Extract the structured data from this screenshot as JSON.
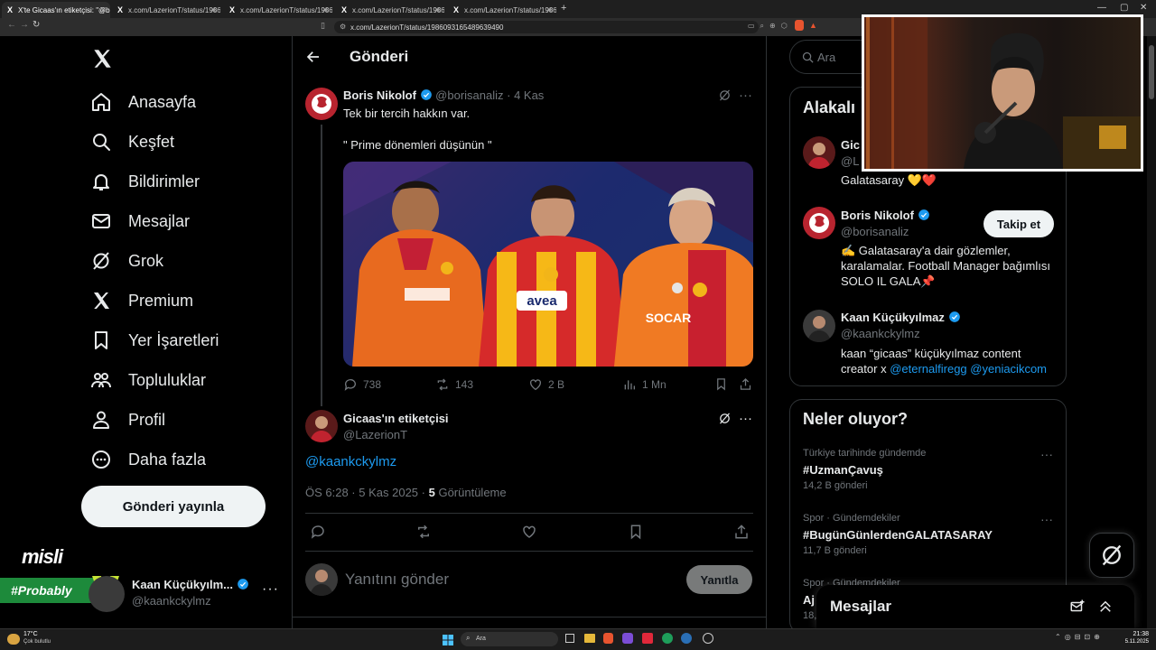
{
  "browser": {
    "tabs": [
      {
        "label": "X'te Gicaas'ın etiketçisi: \"@borisa"
      },
      {
        "label": "x.com/LazerionT/status/198609320"
      },
      {
        "label": "x.com/LazerionT/status/198609330"
      },
      {
        "label": "x.com/LazerionT/status/198609345"
      },
      {
        "label": "x.com/LazerionT/status/198611676"
      }
    ],
    "url": "x.com/LazerionT/status/1986093165489639490"
  },
  "sidebar": {
    "items": [
      {
        "label": "Anasayfa",
        "icon": "home-icon"
      },
      {
        "label": "Keşfet",
        "icon": "search-icon"
      },
      {
        "label": "Bildirimler",
        "icon": "bell-icon"
      },
      {
        "label": "Mesajlar",
        "icon": "mail-icon"
      },
      {
        "label": "Grok",
        "icon": "grok-icon"
      },
      {
        "label": "Premium",
        "icon": "x-logo-icon"
      },
      {
        "label": "Yer İşaretleri",
        "icon": "bookmark-icon"
      },
      {
        "label": "Topluluklar",
        "icon": "communities-icon"
      },
      {
        "label": "Profil",
        "icon": "person-icon"
      },
      {
        "label": "Daha fazla",
        "icon": "more-circle-icon"
      }
    ],
    "post_button": "Gönderi yayınla",
    "account": {
      "name": "Kaan Küçükyılm...",
      "handle": "@kaankckylmz"
    },
    "overlay_logo": "misli",
    "overlay_tag": "#Probably"
  },
  "header": {
    "title": "Gönderi"
  },
  "parent_post": {
    "name": "Boris Nikolof",
    "handle": "@borisanaliz",
    "time": "· 4 Kas",
    "line1": "Tek bir tercih hakkın var.",
    "line2": "\" Prime dönemleri düşünün \"",
    "stats": {
      "replies": "738",
      "reposts": "143",
      "likes": "2 B",
      "views": "1 Mn"
    }
  },
  "main_post": {
    "name": "Gicaas'ın etiketçisi",
    "handle": "@LazerionT",
    "mention": "@kaankckylmz",
    "timestamp": "ÖS 6:28 · 5 Kas 2025 ·",
    "views_count": "5",
    "views_label": "Görüntüleme"
  },
  "reply": {
    "placeholder": "Yanıtını gönder",
    "button": "Yanıtla"
  },
  "right": {
    "search_placeholder": "Ara",
    "related_title": "Alakalı",
    "related": [
      {
        "name": "Gic",
        "handle": "@L",
        "bio": "Galatasaray 💛❤️"
      },
      {
        "name": "Boris Nikolof",
        "handle": "@borisanaliz",
        "bio": "✍️ Galatasaray'a dair gözlemler, karalamalar. Football Manager bağımlısı SOLO IL GALA📌",
        "follow": "Takip et"
      },
      {
        "name": "Kaan Küçükyılmaz",
        "handle": "@kaankckylmz",
        "bio_prefix": "kaan “gicaas” küçükyılmaz content creator x ",
        "bio_link1": "@eternalfiregg",
        "bio_link2": "@yeniacikcom"
      }
    ],
    "trends_title": "Neler oluyor?",
    "trends": [
      {
        "context": "Türkiye tarihinde gündemde",
        "name": "#UzmanÇavuş",
        "count": "14,2 B gönderi"
      },
      {
        "context": "Spor · Gündemdekiler",
        "name": "#BugünGünlerdenGALATASARAY",
        "count": "11,7 B gönderi"
      },
      {
        "context": "Spor · Gündemdekiler",
        "name": "Aj",
        "count": "18,"
      }
    ],
    "messages_title": "Mesajlar"
  },
  "taskbar": {
    "weather_temp": "17°C",
    "weather_desc": "Çok bulutlu",
    "search": "Ara",
    "time": "21:38",
    "date": "5.11.2025"
  }
}
